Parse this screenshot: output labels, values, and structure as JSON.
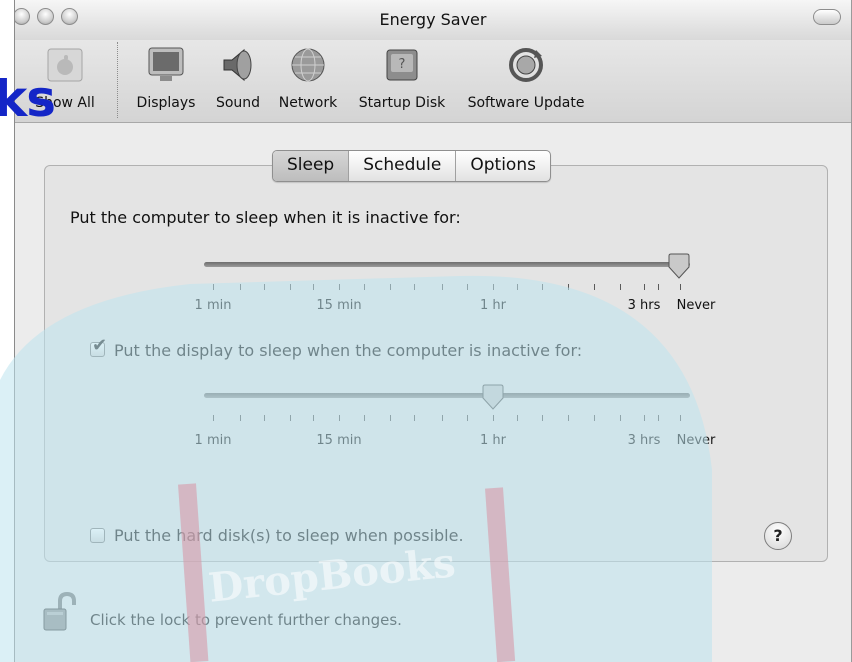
{
  "window": {
    "title": "Energy Saver"
  },
  "toolbar": {
    "items": [
      {
        "label": "Show All",
        "icon": "apple-logo-icon"
      },
      {
        "label": "Displays",
        "icon": "display-icon"
      },
      {
        "label": "Sound",
        "icon": "speaker-icon"
      },
      {
        "label": "Network",
        "icon": "globe-icon"
      },
      {
        "label": "Startup Disk",
        "icon": "hard-disk-icon"
      },
      {
        "label": "Software Update",
        "icon": "software-update-icon"
      }
    ]
  },
  "tabs": [
    {
      "label": "Sleep",
      "selected": true
    },
    {
      "label": "Schedule",
      "selected": false
    },
    {
      "label": "Options",
      "selected": false
    }
  ],
  "sleep": {
    "computer_label": "Put the computer to sleep when it is inactive for:",
    "computer_value": "Never",
    "display_label": "Put the display to sleep when the computer is inactive for:",
    "display_checked": true,
    "display_value": "1 hr",
    "disk_label": "Put the hard disk(s) to sleep when possible.",
    "disk_checked": false,
    "scale_labels": [
      "1 min",
      "15 min",
      "1 hr",
      "3 hrs",
      "Never"
    ]
  },
  "help": {
    "label": "?"
  },
  "lock": {
    "text": "Click the lock to prevent further changes.",
    "icon": "unlocked-padlock-icon"
  },
  "watermark": {
    "text": "ks",
    "sub": "DropBooks"
  },
  "colors": {
    "watermark_blue": "#1426c7",
    "watermark_cyan": "#bde4ee",
    "watermark_red": "#d79aa9"
  }
}
